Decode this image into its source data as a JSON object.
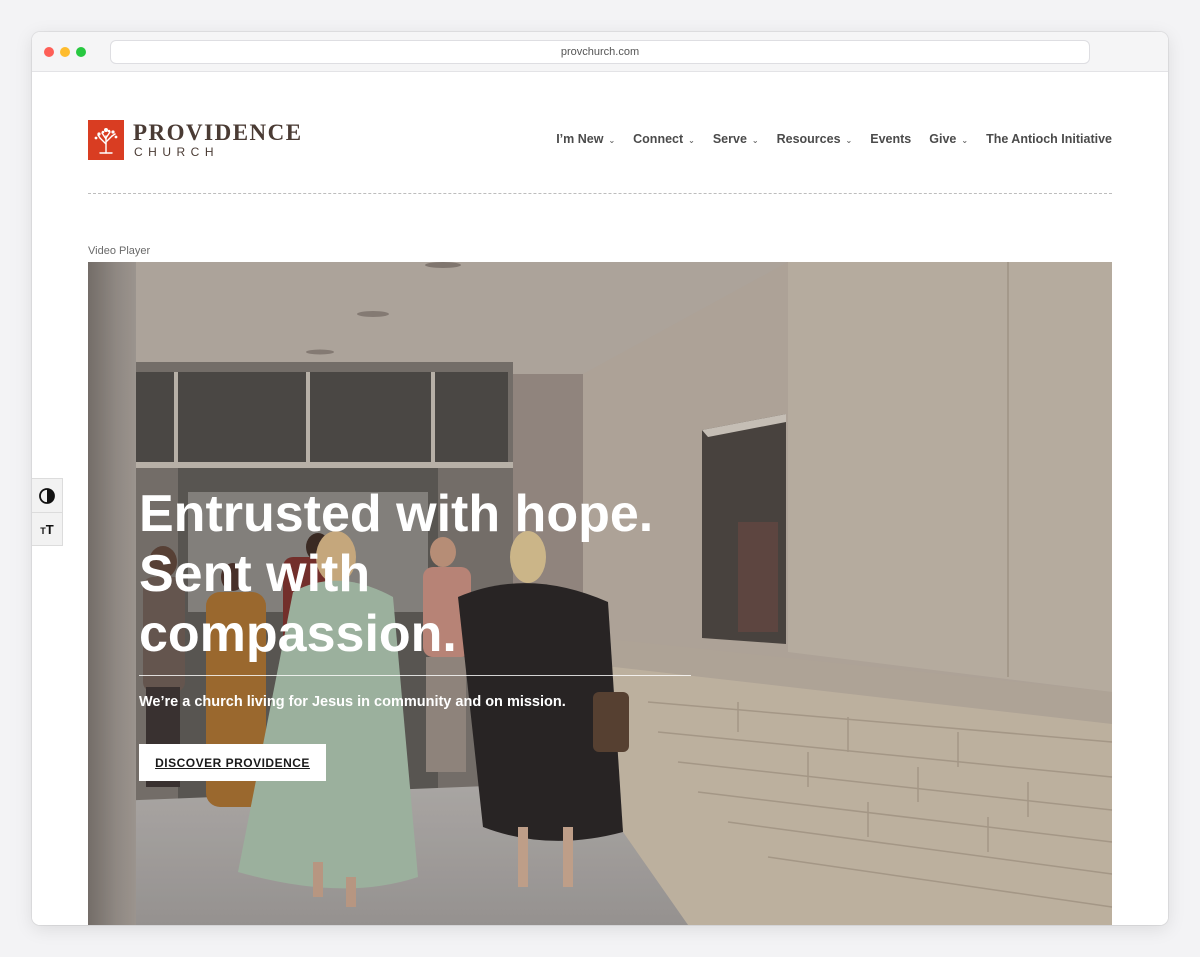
{
  "browser": {
    "url": "provchurch.com"
  },
  "brand": {
    "name": "PROVIDENCE",
    "sub": "CHURCH",
    "color": "#d93d22"
  },
  "nav": {
    "items": [
      {
        "label": "I’m New",
        "dropdown": true
      },
      {
        "label": "Connect",
        "dropdown": true
      },
      {
        "label": "Serve",
        "dropdown": true
      },
      {
        "label": "Resources",
        "dropdown": true
      },
      {
        "label": "Events",
        "dropdown": false
      },
      {
        "label": "Give",
        "dropdown": true
      },
      {
        "label": "The Antioch Initiative",
        "dropdown": false
      }
    ],
    "chevron_icon": "chevron-down-icon"
  },
  "video": {
    "label": "Video Player"
  },
  "hero": {
    "headline_line1": "Entrusted with hope.",
    "headline_line2": "Sent with",
    "headline_line3": "compassion.",
    "subtext": "We’re a church living for Jesus in community and on mission.",
    "cta_label": "DISCOVER PROVIDENCE"
  },
  "accessibility": {
    "contrast_icon": "contrast-icon",
    "text_size_icon": "text-size-icon",
    "text_size_glyph": "T"
  }
}
